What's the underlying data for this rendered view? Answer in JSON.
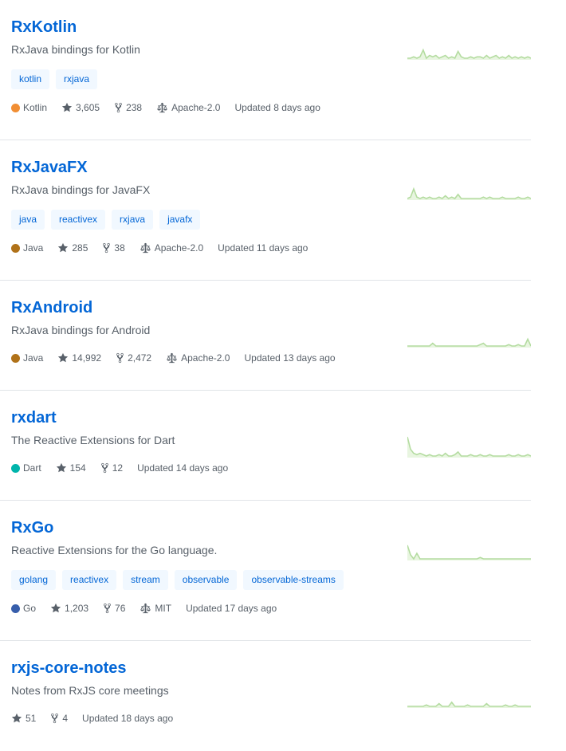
{
  "colors": {
    "link": "#0366d6",
    "muted": "#586069",
    "topic_bg": "#f1f8ff",
    "spark_stroke": "#b4dca0",
    "spark_fill": "#e8f5e0"
  },
  "repos": [
    {
      "name": "RxKotlin",
      "description": "RxJava bindings for Kotlin",
      "topics": [
        "kotlin",
        "rxjava"
      ],
      "language": "Kotlin",
      "language_color": "#F18E33",
      "stars": "3,605",
      "forks": "238",
      "license": "Apache-2.0",
      "updated": "Updated 8 days ago",
      "activity": [
        0,
        0,
        1,
        0,
        1,
        6,
        0,
        2,
        1,
        2,
        0,
        1,
        2,
        0,
        1,
        0,
        5,
        1,
        0,
        0,
        1,
        0,
        1,
        1,
        0,
        2,
        0,
        1,
        2,
        0,
        1,
        0,
        2,
        0,
        1,
        0,
        1,
        0,
        1,
        0
      ]
    },
    {
      "name": "RxJavaFX",
      "description": "RxJava bindings for JavaFX",
      "topics": [
        "java",
        "reactivex",
        "rxjava",
        "javafx"
      ],
      "language": "Java",
      "language_color": "#b07219",
      "stars": "285",
      "forks": "38",
      "license": "Apache-2.0",
      "updated": "Updated 11 days ago",
      "activity": [
        0,
        1,
        7,
        1,
        0,
        1,
        0,
        1,
        0,
        0,
        1,
        0,
        2,
        0,
        1,
        0,
        3,
        0,
        0,
        0,
        0,
        0,
        0,
        0,
        1,
        0,
        1,
        0,
        0,
        0,
        1,
        0,
        0,
        0,
        0,
        1,
        0,
        0,
        1,
        0
      ]
    },
    {
      "name": "RxAndroid",
      "description": "RxJava bindings for Android",
      "topics": [],
      "language": "Java",
      "language_color": "#b07219",
      "stars": "14,992",
      "forks": "2,472",
      "license": "Apache-2.0",
      "updated": "Updated 13 days ago",
      "activity": [
        0,
        0,
        0,
        0,
        0,
        0,
        0,
        0,
        2,
        0,
        0,
        0,
        0,
        0,
        0,
        0,
        0,
        0,
        0,
        0,
        0,
        0,
        0,
        1,
        2,
        0,
        0,
        0,
        0,
        0,
        0,
        0,
        1,
        0,
        0,
        1,
        0,
        0,
        5,
        0
      ]
    },
    {
      "name": "rxdart",
      "description": "The Reactive Extensions for Dart",
      "topics": [],
      "language": "Dart",
      "language_color": "#00B4AB",
      "stars": "154",
      "forks": "12",
      "license": "",
      "updated": "Updated 14 days ago",
      "activity": [
        14,
        5,
        2,
        1,
        2,
        1,
        0,
        1,
        0,
        0,
        1,
        0,
        2,
        0,
        0,
        1,
        3,
        0,
        0,
        0,
        1,
        0,
        0,
        1,
        0,
        0,
        1,
        0,
        0,
        0,
        0,
        0,
        1,
        0,
        0,
        1,
        0,
        0,
        1,
        0
      ]
    },
    {
      "name": "RxGo",
      "description": "Reactive Extensions for the Go language.",
      "topics": [
        "golang",
        "reactivex",
        "stream",
        "observable",
        "observable-streams"
      ],
      "language": "Go",
      "language_color": "#375eab",
      "stars": "1,203",
      "forks": "76",
      "license": "MIT",
      "updated": "Updated 17 days ago",
      "activity": [
        10,
        3,
        0,
        4,
        0,
        0,
        0,
        0,
        0,
        0,
        0,
        0,
        0,
        0,
        0,
        0,
        0,
        0,
        0,
        0,
        0,
        0,
        0,
        1,
        0,
        0,
        0,
        0,
        0,
        0,
        0,
        0,
        0,
        0,
        0,
        0,
        0,
        0,
        0,
        0
      ]
    },
    {
      "name": "rxjs-core-notes",
      "description": "Notes from RxJS core meetings",
      "topics": [],
      "language": "",
      "language_color": "",
      "stars": "51",
      "forks": "4",
      "license": "",
      "updated": "Updated 18 days ago",
      "activity": [
        0,
        0,
        0,
        0,
        0,
        0,
        1,
        0,
        0,
        0,
        2,
        0,
        0,
        0,
        3,
        0,
        0,
        0,
        0,
        1,
        0,
        0,
        0,
        0,
        0,
        2,
        0,
        0,
        0,
        0,
        0,
        1,
        0,
        0,
        1,
        0,
        0,
        0,
        0,
        0
      ]
    }
  ]
}
